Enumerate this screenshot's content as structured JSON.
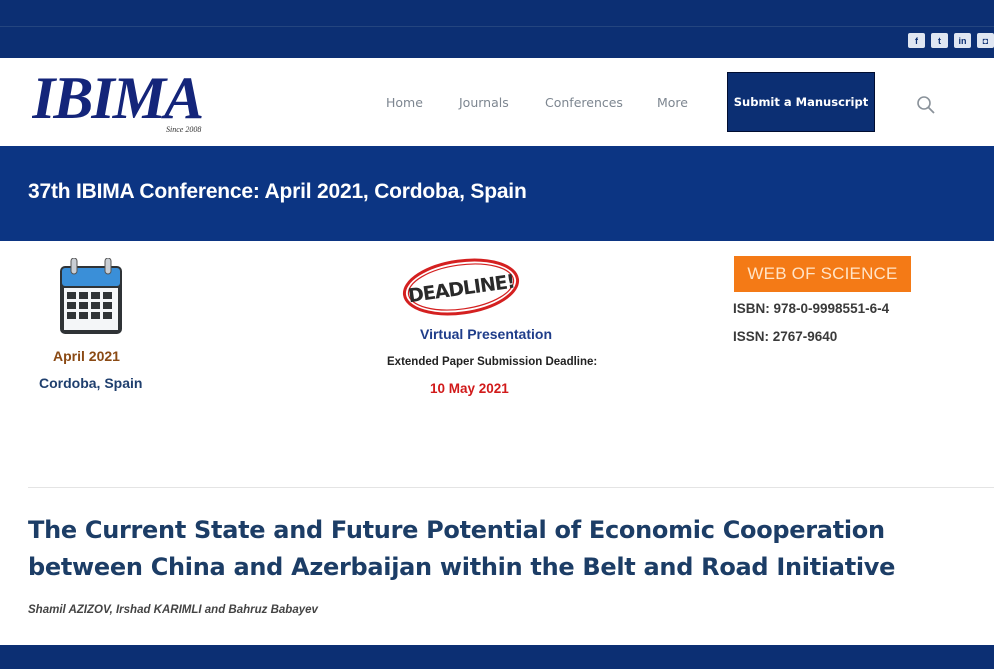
{
  "colors": {
    "brand_navy": "#0c2f73",
    "banner_blue": "#0c3583",
    "orange": "#f47a16",
    "title_blue": "#1c3d66",
    "deadline_red": "#d11a1a"
  },
  "social": [
    "facebook-icon",
    "twitter-icon",
    "linkedin-icon",
    "instagram-icon"
  ],
  "logo": {
    "text": "IBIMA",
    "tagline": "Since 2008"
  },
  "nav": {
    "home": "Home",
    "journals": "Journals",
    "conferences": "Conferences",
    "more": "More",
    "submit": "Submit a Manuscript",
    "search_icon": "search-icon"
  },
  "banner": {
    "title": "37th IBIMA Conference: April 2021, Cordoba, Spain"
  },
  "info": {
    "calendar_icon": "calendar-icon",
    "date": "April 2021",
    "location": "Cordoba, Spain",
    "stamp_text": "DEADLINE!",
    "virtual": "Virtual Presentation",
    "extended_label": "Extended Paper Submission Deadline:",
    "deadline_date": "10 May 2021",
    "wos": "WEB OF SCIENCE",
    "isbn": "ISBN: 978-0-9998551-6-4",
    "issn": "ISSN: 2767-9640"
  },
  "paper": {
    "title": "The Current State and Future Potential of Economic Cooperation between China and Azerbaijan within the Belt and Road Initiative",
    "authors": "Shamil AZIZOV, Irshad KARIMLI and Bahruz Babayev"
  }
}
